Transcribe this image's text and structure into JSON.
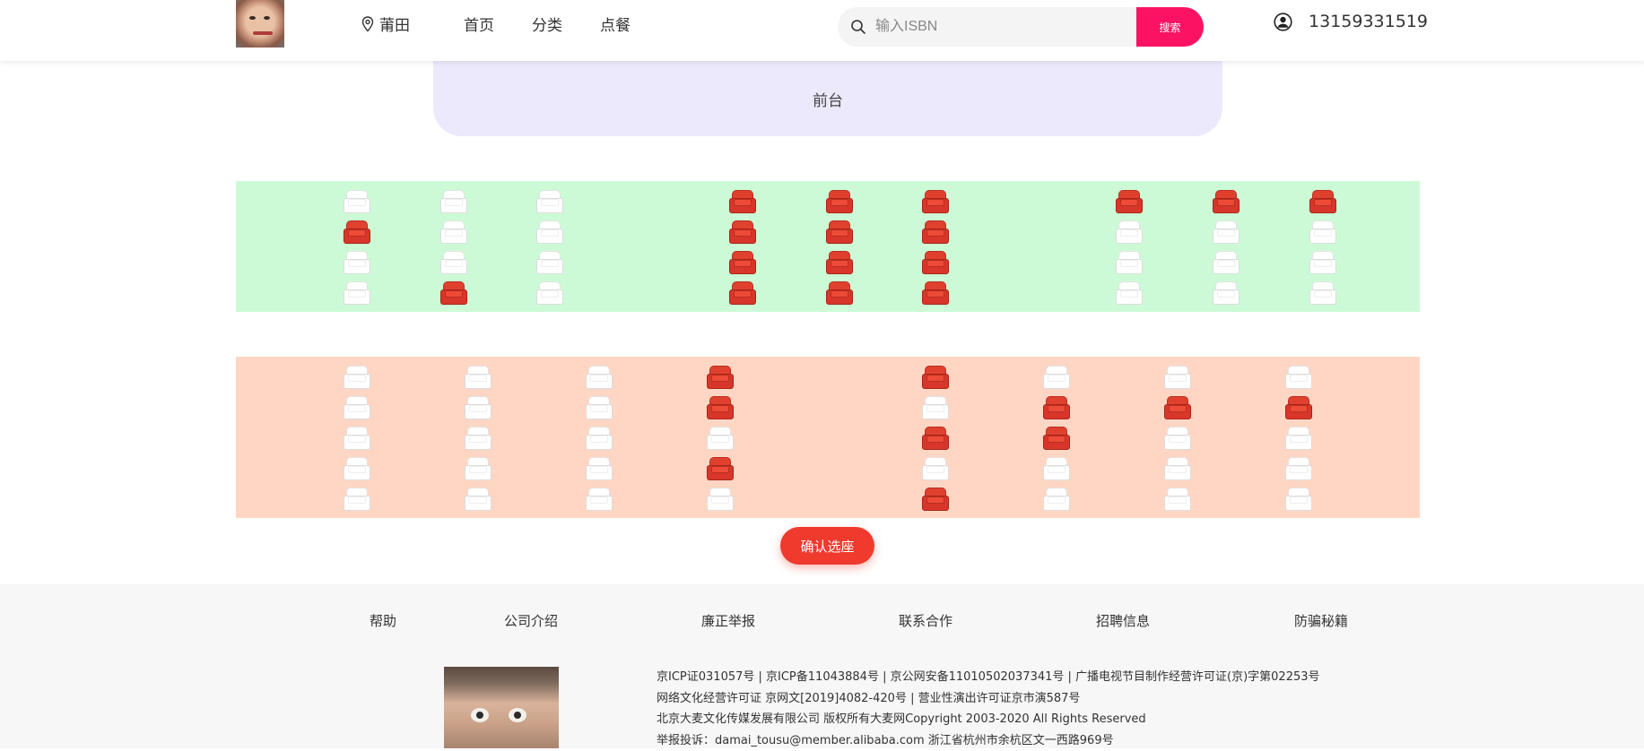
{
  "header": {
    "location": "莆田",
    "nav": [
      "首页",
      "分类",
      "点餐"
    ],
    "search": {
      "placeholder": "输入ISBN",
      "button": "搜索"
    },
    "user_phone": "13159331519"
  },
  "stage_label": "前台",
  "seat_sections": [
    {
      "name": "section-a",
      "color": "#cdfad6",
      "rows": [
        [
          0,
          0,
          0,
          1,
          1,
          1,
          1,
          1,
          1
        ],
        [
          1,
          0,
          0,
          1,
          1,
          1,
          0,
          0,
          0
        ],
        [
          0,
          0,
          0,
          1,
          1,
          1,
          0,
          0,
          0
        ],
        [
          0,
          1,
          0,
          1,
          1,
          1,
          0,
          0,
          0
        ]
      ]
    },
    {
      "name": "section-b",
      "color": "#ffd6c4",
      "rows": [
        [
          0,
          0,
          0,
          1,
          1,
          0,
          0,
          0
        ],
        [
          0,
          0,
          0,
          1,
          0,
          1,
          1,
          1
        ],
        [
          0,
          0,
          0,
          0,
          1,
          1,
          0,
          0
        ],
        [
          0,
          0,
          0,
          1,
          0,
          0,
          0,
          0
        ],
        [
          0,
          0,
          0,
          0,
          1,
          0,
          0,
          0
        ]
      ]
    }
  ],
  "seat_colors": {
    "available": "#ffffff",
    "taken": "#e0412f"
  },
  "confirm_button": "确认选座",
  "footer": {
    "links": [
      "帮助",
      "公司介绍",
      "廉正举报",
      "联系合作",
      "招聘信息",
      "防骗秘籍"
    ],
    "lines": [
      "京ICP证031057号   |   京ICP备11043884号   |   京公网安备11010502037341号   |   广播电视节目制作经营许可证(京)字第02253号",
      "网络文化经营许可证 京网文[2019]4082-420号   |   营业性演出许可证京市演587号",
      "北京大麦文化传媒发展有限公司 版权所有大麦网Copyright 2003-2020 All Rights Reserved",
      "举报投诉：damai_tousu@member.alibaba.com 浙江省杭州市余杭区文一西路969号"
    ]
  },
  "icons": {
    "location": "location-pin-icon",
    "search": "search-icon",
    "user": "user-circle-icon"
  }
}
